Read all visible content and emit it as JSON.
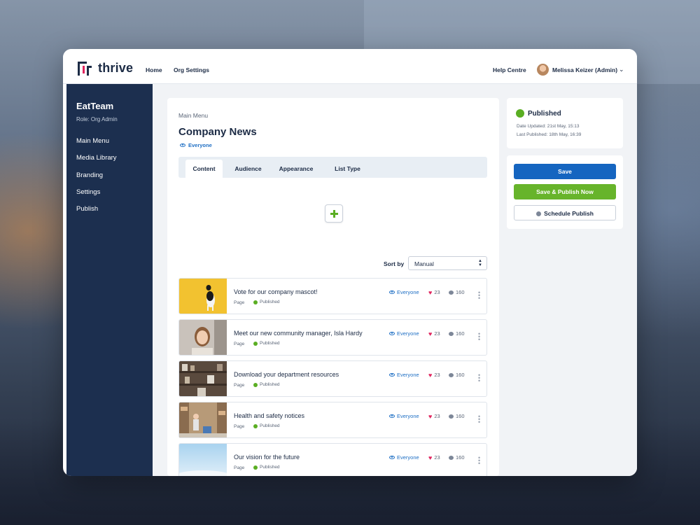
{
  "app": {
    "logo_text": "thrive",
    "nav": [
      "Home",
      "Org Settings"
    ],
    "help": "Help Centre",
    "user": "Melissa Keizer (Admin)"
  },
  "sidebar": {
    "team": "EatTeam",
    "role": "Role: Org Admin",
    "items": [
      "Main Menu",
      "Media Library",
      "Branding",
      "Settings",
      "Publish"
    ]
  },
  "main": {
    "breadcrumb": "Main Menu",
    "title": "Company News",
    "audience": "Everyone",
    "tabs": [
      "Content",
      "Audience",
      "Appearance",
      "List Type"
    ],
    "active_tab": "Content",
    "sort_label": "Sort by",
    "sort_value": "Manual",
    "items": [
      {
        "title": "Vote for our company mascot!",
        "type": "Page",
        "status": "Published",
        "audience": "Everyone",
        "likes": "23",
        "comments": "160"
      },
      {
        "title": "Meet our new community manager, Isla Hardy",
        "type": "Page",
        "status": "Published",
        "audience": "Everyone",
        "likes": "23",
        "comments": "160"
      },
      {
        "title": "Download your department resources",
        "type": "Page",
        "status": "Published",
        "audience": "Everyone",
        "likes": "23",
        "comments": "160"
      },
      {
        "title": "Health and safety notices",
        "type": "Page",
        "status": "Published",
        "audience": "Everyone",
        "likes": "23",
        "comments": "160"
      },
      {
        "title": "Our vision for the future",
        "type": "Page",
        "status": "Published",
        "audience": "Everyone",
        "likes": "23",
        "comments": "160"
      }
    ]
  },
  "status_card": {
    "title": "Published",
    "date_updated": "Date Updated: 21st May, 15:13",
    "last_published": "Last Published: 18th May, 16:39"
  },
  "actions": {
    "save": "Save",
    "save_publish": "Save & Publish Now",
    "schedule": "Schedule Publish"
  },
  "colors": {
    "navy": "#1c2f4f",
    "primary": "#1565c0",
    "success": "#67b42b",
    "heart": "#e0245e"
  }
}
